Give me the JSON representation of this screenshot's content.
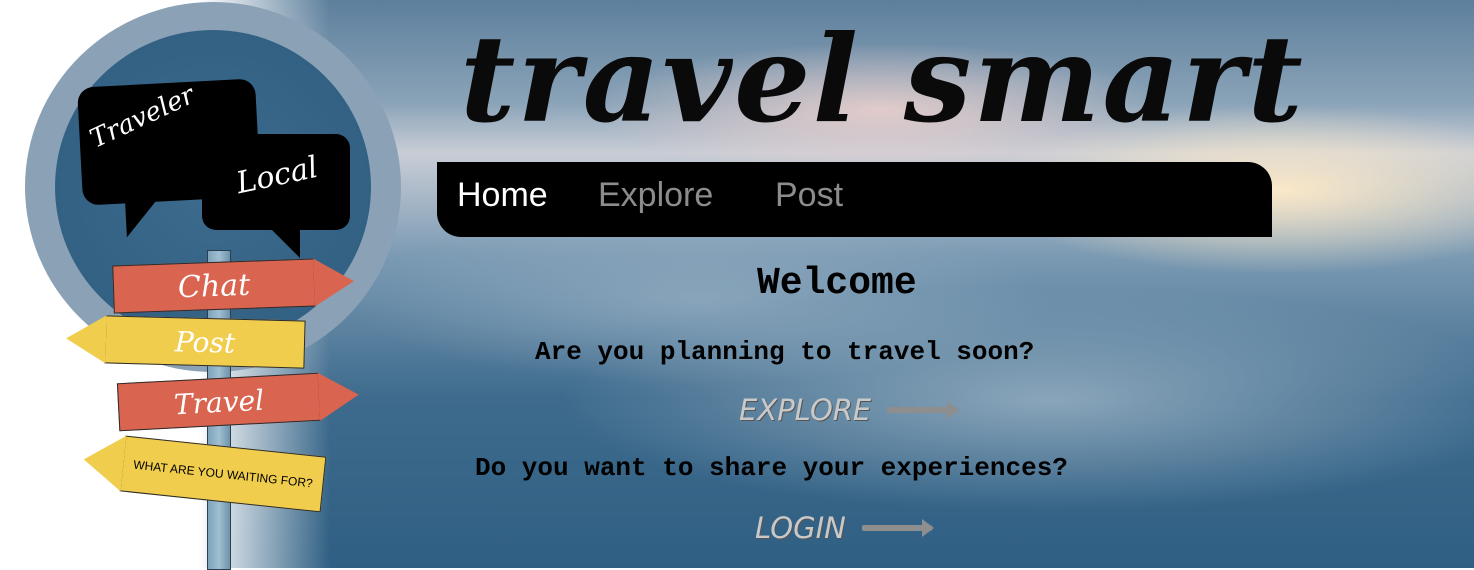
{
  "site": {
    "title": "travel smart"
  },
  "logo": {
    "bubble_traveler": "Traveler",
    "bubble_local": "Local",
    "signs": {
      "chat": "Chat",
      "post": "Post",
      "travel": "Travel",
      "waiting": "WHAT ARE YOU WAITING FOR?"
    }
  },
  "nav": {
    "items": [
      {
        "label": "Home",
        "active": true
      },
      {
        "label": "Explore",
        "active": false
      },
      {
        "label": "Post",
        "active": false
      }
    ]
  },
  "main": {
    "welcome": "Welcome",
    "question_travel": "Are you planning to travel soon?",
    "explore_cta": "EXPLORE",
    "question_share": "Do you want to share your experiences?",
    "login_cta": "LOGIN"
  },
  "colors": {
    "nav_bg": "#000000",
    "nav_active": "#ffffff",
    "nav_inactive": "#8c8c8c",
    "sign_red": "#d9644f",
    "sign_yellow": "#f1cd4d",
    "logo_circle": "#8aa1b6"
  }
}
